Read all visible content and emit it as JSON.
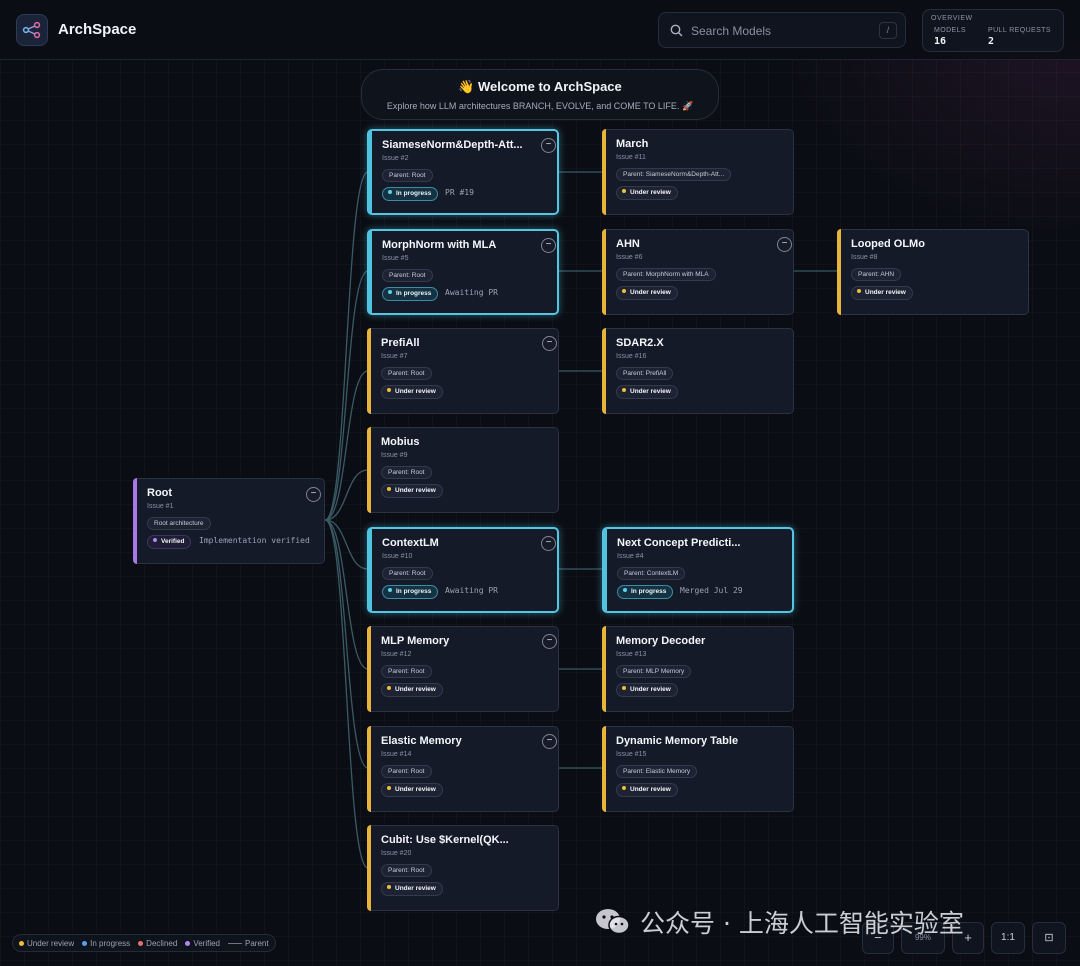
{
  "app": {
    "title": "ArchSpace"
  },
  "search": {
    "placeholder": "Search Models",
    "shortcut": "/"
  },
  "overview": {
    "title": "OVERVIEW",
    "models_label": "MODELS",
    "models_value": "16",
    "pulls_label": "PULL REQUESTS",
    "pulls_value": "2"
  },
  "welcome": {
    "title": "👋 Welcome to ArchSpace",
    "subtitle": "Explore how LLM architectures BRANCH, EVOLVE, and COME TO LIFE. 🚀"
  },
  "root": {
    "title": "Root",
    "issue": "Issue #1",
    "parent": "Root architecture",
    "status": "Verified",
    "note": "Implementation verified",
    "accent": "#a877e8"
  },
  "nodes": [
    {
      "title": "SiameseNorm&Depth-Att...",
      "issue": "Issue #2",
      "parent": "Parent: Root",
      "status": "In progress",
      "note": "PR #19"
    },
    {
      "title": "MorphNorm with MLA",
      "issue": "Issue #5",
      "parent": "Parent: Root",
      "status": "In progress",
      "note": "Awaiting PR"
    },
    {
      "title": "PrefiAll",
      "issue": "Issue #7",
      "parent": "Parent: Root",
      "status": "Under review",
      "note": ""
    },
    {
      "title": "Mobius",
      "issue": "Issue #9",
      "parent": "Parent: Root",
      "status": "Under review",
      "note": ""
    },
    {
      "title": "ContextLM",
      "issue": "Issue #10",
      "parent": "Parent: Root",
      "status": "In progress",
      "note": "Awaiting PR"
    },
    {
      "title": "MLP Memory",
      "issue": "Issue #12",
      "parent": "Parent: Root",
      "status": "Under review",
      "note": ""
    },
    {
      "title": "Elastic Memory",
      "issue": "Issue #14",
      "parent": "Parent: Root",
      "status": "Under review",
      "note": ""
    },
    {
      "title": "Cubit: Use $Kernel(QK...",
      "issue": "Issue #20",
      "parent": "Parent: Root",
      "status": "Under review",
      "note": ""
    },
    {
      "title": "March",
      "issue": "Issue #11",
      "parent": "Parent: SiameseNorm&Depth-Att...",
      "status": "Under review",
      "note": ""
    },
    {
      "title": "AHN",
      "issue": "Issue #6",
      "parent": "Parent: MorphNorm with MLA",
      "status": "Under review",
      "note": ""
    },
    {
      "title": "Looped OLMo",
      "issue": "Issue #8",
      "parent": "Parent: AHN",
      "status": "Under review",
      "note": ""
    },
    {
      "title": "SDAR2.X",
      "issue": "Issue #16",
      "parent": "Parent: PrefiAll",
      "status": "Under review",
      "note": ""
    },
    {
      "title": "Next Concept Predicti...",
      "issue": "Issue #4",
      "parent": "Parent: ContextLM",
      "status": "In progress",
      "note": "Merged Jul 29"
    },
    {
      "title": "Memory Decoder",
      "issue": "Issue #13",
      "parent": "Parent: MLP Memory",
      "status": "Under review",
      "note": ""
    },
    {
      "title": "Dynamic Memory Table",
      "issue": "Issue #15",
      "parent": "Parent: Elastic Memory",
      "status": "Under review",
      "note": ""
    }
  ],
  "legend": {
    "under_review": "Under review",
    "in_progress": "In progress",
    "declined": "Declined",
    "verified": "Verified",
    "parent": "Parent",
    "colors": {
      "under_review": "#efbf3a",
      "in_progress": "#5aa0f0",
      "declined": "#e8706a",
      "verified": "#b486f0"
    }
  },
  "zoom": {
    "minus": "−",
    "value": "99%",
    "plus": "+",
    "reset": "1:1",
    "fit": "⊡"
  },
  "watermark": {
    "text": "公众号 · 上海人工智能实验室"
  },
  "colors": {
    "accent_review": "#e8b43a",
    "accent_progress": "#4fc3df",
    "accent_verified": "#a877e8",
    "background": "#0b0d14"
  }
}
